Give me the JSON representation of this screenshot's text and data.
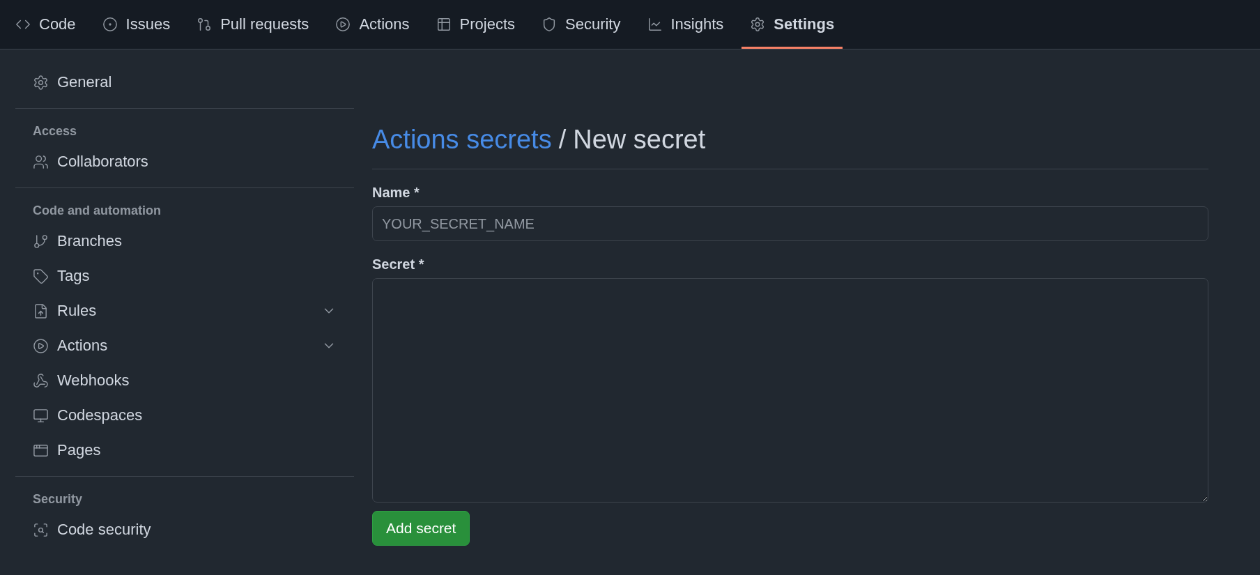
{
  "nav": {
    "tabs": [
      {
        "label": "Code",
        "selected": false
      },
      {
        "label": "Issues",
        "selected": false
      },
      {
        "label": "Pull requests",
        "selected": false
      },
      {
        "label": "Actions",
        "selected": false
      },
      {
        "label": "Projects",
        "selected": false
      },
      {
        "label": "Security",
        "selected": false
      },
      {
        "label": "Insights",
        "selected": false
      },
      {
        "label": "Settings",
        "selected": true
      }
    ]
  },
  "sidebar": {
    "groups": [
      {
        "items": [
          {
            "label": "General"
          }
        ]
      },
      {
        "heading": "Access",
        "items": [
          {
            "label": "Collaborators"
          }
        ]
      },
      {
        "heading": "Code and automation",
        "items": [
          {
            "label": "Branches"
          },
          {
            "label": "Tags"
          },
          {
            "label": "Rules",
            "expanded": false
          },
          {
            "label": "Actions",
            "expanded": false
          },
          {
            "label": "Webhooks"
          },
          {
            "label": "Codespaces"
          },
          {
            "label": "Pages"
          }
        ]
      },
      {
        "heading": "Security",
        "items": [
          {
            "label": "Code security"
          }
        ]
      }
    ]
  },
  "form": {
    "breadcrumb": {
      "link": "Actions secrets",
      "separator": "/",
      "current": "New secret"
    },
    "name_label": "Name *",
    "name_field": {
      "placeholder": "YOUR_SECRET_NAME"
    },
    "secret_label": "Secret *",
    "submit": "Add secret"
  }
}
